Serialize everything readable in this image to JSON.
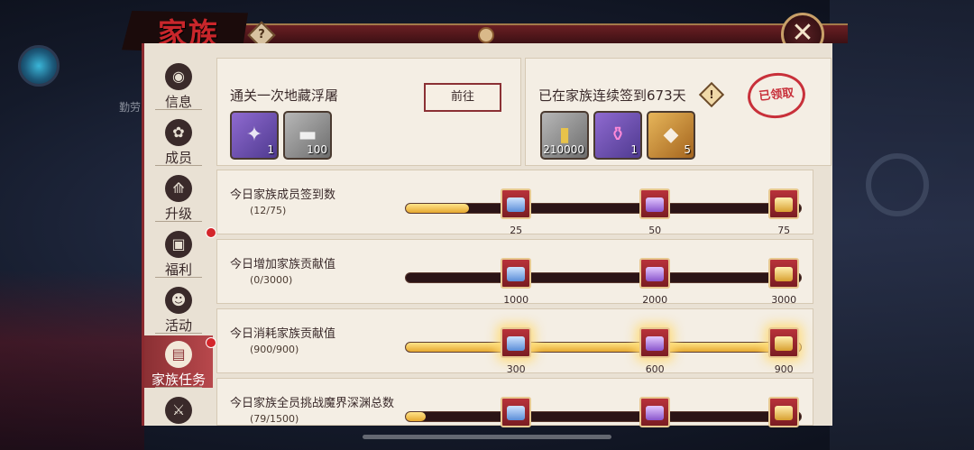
{
  "window": {
    "title": "家族",
    "help": "?",
    "close": "✕"
  },
  "background": {
    "side_text": "勤劳"
  },
  "sidebar": {
    "items": [
      {
        "label": "信息",
        "icon": "info-icon",
        "glyph": "◉",
        "badge": false,
        "active": false
      },
      {
        "label": "成员",
        "icon": "members-icon",
        "glyph": "✿",
        "badge": false,
        "active": false
      },
      {
        "label": "升级",
        "icon": "upgrade-icon",
        "glyph": "⟰",
        "badge": false,
        "active": false
      },
      {
        "label": "福利",
        "icon": "gift-icon",
        "glyph": "▣",
        "badge": true,
        "active": false
      },
      {
        "label": "活动",
        "icon": "activity-icon",
        "glyph": "☻",
        "badge": false,
        "active": false
      },
      {
        "label": "家族任务",
        "icon": "task-icon",
        "glyph": "▤",
        "badge": true,
        "active": true
      },
      {
        "label": "",
        "icon": "battle-icon",
        "glyph": "⚔",
        "badge": false,
        "active": false
      }
    ]
  },
  "task_card": {
    "title": "通关一次地藏浮屠",
    "goto_label": "前往",
    "rewards": [
      {
        "icon": "puzzle-icon",
        "qty": "1",
        "rarity": "purple"
      },
      {
        "icon": "iron-ingot-icon",
        "qty": "100",
        "rarity": "gray"
      }
    ]
  },
  "signin_card": {
    "title": "已在家族连续签到673天",
    "warn": "!",
    "stamp": "已领取",
    "rewards": [
      {
        "icon": "gold-token-icon",
        "qty": "210000",
        "rarity": "gray"
      },
      {
        "icon": "potion-icon",
        "qty": "1",
        "rarity": "purple"
      },
      {
        "icon": "crystal-icon",
        "qty": "5",
        "rarity": "gold"
      }
    ]
  },
  "rows": [
    {
      "title": "今日家族成员签到数",
      "count": "(12/75)",
      "progress": 0.16,
      "glow": false,
      "milestones": [
        {
          "label": "25",
          "chest": "blue"
        },
        {
          "label": "50",
          "chest": "purple"
        },
        {
          "label": "75",
          "chest": "gold"
        }
      ]
    },
    {
      "title": "今日增加家族贡献值",
      "count": "(0/3000)",
      "progress": 0.0,
      "glow": false,
      "milestones": [
        {
          "label": "1000",
          "chest": "blue"
        },
        {
          "label": "2000",
          "chest": "purple"
        },
        {
          "label": "3000",
          "chest": "gold"
        }
      ]
    },
    {
      "title": "今日消耗家族贡献值",
      "count": "(900/900)",
      "progress": 1.0,
      "glow": true,
      "milestones": [
        {
          "label": "300",
          "chest": "blue"
        },
        {
          "label": "600",
          "chest": "purple"
        },
        {
          "label": "900",
          "chest": "gold"
        }
      ]
    },
    {
      "title": "今日家族全员挑战魔界深渊总数",
      "count": "(79/1500)",
      "progress": 0.05,
      "glow": false,
      "milestones": [
        {
          "label": "",
          "chest": "blue"
        },
        {
          "label": "",
          "chest": "purple"
        },
        {
          "label": "",
          "chest": "gold"
        }
      ]
    }
  ]
}
